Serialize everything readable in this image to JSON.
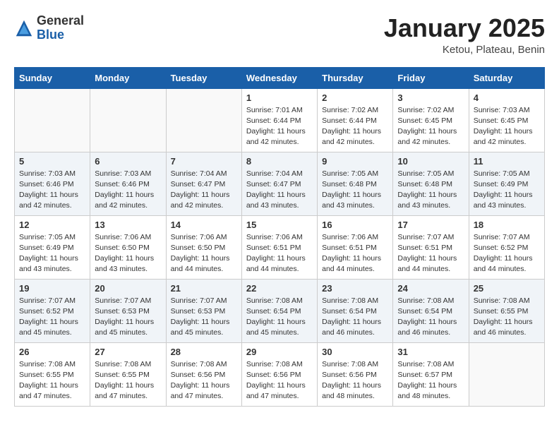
{
  "header": {
    "logo_general": "General",
    "logo_blue": "Blue",
    "month_title": "January 2025",
    "subtitle": "Ketou, Plateau, Benin"
  },
  "weekdays": [
    "Sunday",
    "Monday",
    "Tuesday",
    "Wednesday",
    "Thursday",
    "Friday",
    "Saturday"
  ],
  "weeks": [
    [
      {
        "day": "",
        "info": ""
      },
      {
        "day": "",
        "info": ""
      },
      {
        "day": "",
        "info": ""
      },
      {
        "day": "1",
        "info": "Sunrise: 7:01 AM\nSunset: 6:44 PM\nDaylight: 11 hours\nand 42 minutes."
      },
      {
        "day": "2",
        "info": "Sunrise: 7:02 AM\nSunset: 6:44 PM\nDaylight: 11 hours\nand 42 minutes."
      },
      {
        "day": "3",
        "info": "Sunrise: 7:02 AM\nSunset: 6:45 PM\nDaylight: 11 hours\nand 42 minutes."
      },
      {
        "day": "4",
        "info": "Sunrise: 7:03 AM\nSunset: 6:45 PM\nDaylight: 11 hours\nand 42 minutes."
      }
    ],
    [
      {
        "day": "5",
        "info": "Sunrise: 7:03 AM\nSunset: 6:46 PM\nDaylight: 11 hours\nand 42 minutes."
      },
      {
        "day": "6",
        "info": "Sunrise: 7:03 AM\nSunset: 6:46 PM\nDaylight: 11 hours\nand 42 minutes."
      },
      {
        "day": "7",
        "info": "Sunrise: 7:04 AM\nSunset: 6:47 PM\nDaylight: 11 hours\nand 42 minutes."
      },
      {
        "day": "8",
        "info": "Sunrise: 7:04 AM\nSunset: 6:47 PM\nDaylight: 11 hours\nand 43 minutes."
      },
      {
        "day": "9",
        "info": "Sunrise: 7:05 AM\nSunset: 6:48 PM\nDaylight: 11 hours\nand 43 minutes."
      },
      {
        "day": "10",
        "info": "Sunrise: 7:05 AM\nSunset: 6:48 PM\nDaylight: 11 hours\nand 43 minutes."
      },
      {
        "day": "11",
        "info": "Sunrise: 7:05 AM\nSunset: 6:49 PM\nDaylight: 11 hours\nand 43 minutes."
      }
    ],
    [
      {
        "day": "12",
        "info": "Sunrise: 7:05 AM\nSunset: 6:49 PM\nDaylight: 11 hours\nand 43 minutes."
      },
      {
        "day": "13",
        "info": "Sunrise: 7:06 AM\nSunset: 6:50 PM\nDaylight: 11 hours\nand 43 minutes."
      },
      {
        "day": "14",
        "info": "Sunrise: 7:06 AM\nSunset: 6:50 PM\nDaylight: 11 hours\nand 44 minutes."
      },
      {
        "day": "15",
        "info": "Sunrise: 7:06 AM\nSunset: 6:51 PM\nDaylight: 11 hours\nand 44 minutes."
      },
      {
        "day": "16",
        "info": "Sunrise: 7:06 AM\nSunset: 6:51 PM\nDaylight: 11 hours\nand 44 minutes."
      },
      {
        "day": "17",
        "info": "Sunrise: 7:07 AM\nSunset: 6:51 PM\nDaylight: 11 hours\nand 44 minutes."
      },
      {
        "day": "18",
        "info": "Sunrise: 7:07 AM\nSunset: 6:52 PM\nDaylight: 11 hours\nand 44 minutes."
      }
    ],
    [
      {
        "day": "19",
        "info": "Sunrise: 7:07 AM\nSunset: 6:52 PM\nDaylight: 11 hours\nand 45 minutes."
      },
      {
        "day": "20",
        "info": "Sunrise: 7:07 AM\nSunset: 6:53 PM\nDaylight: 11 hours\nand 45 minutes."
      },
      {
        "day": "21",
        "info": "Sunrise: 7:07 AM\nSunset: 6:53 PM\nDaylight: 11 hours\nand 45 minutes."
      },
      {
        "day": "22",
        "info": "Sunrise: 7:08 AM\nSunset: 6:54 PM\nDaylight: 11 hours\nand 45 minutes."
      },
      {
        "day": "23",
        "info": "Sunrise: 7:08 AM\nSunset: 6:54 PM\nDaylight: 11 hours\nand 46 minutes."
      },
      {
        "day": "24",
        "info": "Sunrise: 7:08 AM\nSunset: 6:54 PM\nDaylight: 11 hours\nand 46 minutes."
      },
      {
        "day": "25",
        "info": "Sunrise: 7:08 AM\nSunset: 6:55 PM\nDaylight: 11 hours\nand 46 minutes."
      }
    ],
    [
      {
        "day": "26",
        "info": "Sunrise: 7:08 AM\nSunset: 6:55 PM\nDaylight: 11 hours\nand 47 minutes."
      },
      {
        "day": "27",
        "info": "Sunrise: 7:08 AM\nSunset: 6:55 PM\nDaylight: 11 hours\nand 47 minutes."
      },
      {
        "day": "28",
        "info": "Sunrise: 7:08 AM\nSunset: 6:56 PM\nDaylight: 11 hours\nand 47 minutes."
      },
      {
        "day": "29",
        "info": "Sunrise: 7:08 AM\nSunset: 6:56 PM\nDaylight: 11 hours\nand 47 minutes."
      },
      {
        "day": "30",
        "info": "Sunrise: 7:08 AM\nSunset: 6:56 PM\nDaylight: 11 hours\nand 48 minutes."
      },
      {
        "day": "31",
        "info": "Sunrise: 7:08 AM\nSunset: 6:57 PM\nDaylight: 11 hours\nand 48 minutes."
      },
      {
        "day": "",
        "info": ""
      }
    ]
  ]
}
